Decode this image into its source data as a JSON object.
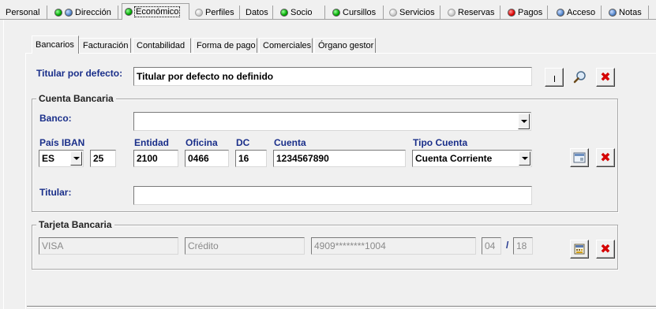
{
  "top_tabs": [
    {
      "label": "Personal",
      "leds": []
    },
    {
      "label": "Dirección",
      "leds": [
        "green",
        "blue"
      ]
    },
    {
      "label": "Económico",
      "leds": [
        "green"
      ]
    },
    {
      "label": "Perfiles",
      "leds": [
        "gray"
      ]
    },
    {
      "label": "Datos",
      "leds": []
    },
    {
      "label": "Socio",
      "leds": [
        "green"
      ]
    },
    {
      "label": "Cursillos",
      "leds": [
        "green"
      ]
    },
    {
      "label": "Servicios",
      "leds": [
        "gray"
      ]
    },
    {
      "label": "Reservas",
      "leds": [
        "gray"
      ]
    },
    {
      "label": "Pagos",
      "leds": [
        "red"
      ]
    },
    {
      "label": "Acceso",
      "leds": [
        "blue"
      ]
    },
    {
      "label": "Notas",
      "leds": [
        "blue"
      ]
    }
  ],
  "sub_tabs": [
    "Bancarios",
    "Facturación",
    "Contabilidad",
    "Forma de pago",
    "Comerciales",
    "Órgano gestor"
  ],
  "titular_defecto": {
    "label": "Titular por defecto:",
    "value": "Titular por defecto no definido"
  },
  "cuenta": {
    "legend": "Cuenta Bancaria",
    "banco_label": "Banco:",
    "banco_value": "",
    "pais_label": "País IBAN",
    "pais_value": "ES",
    "iban_check": "25",
    "entidad_label": "Entidad",
    "entidad_value": "2100",
    "oficina_label": "Oficina",
    "oficina_value": "0466",
    "dc_label": "DC",
    "dc_value": "16",
    "cuenta_label": "Cuenta",
    "cuenta_value": "1234567890",
    "tipo_label": "Tipo Cuenta",
    "tipo_value": "Cuenta Corriente",
    "titular_label": "Titular:",
    "titular_value": ""
  },
  "tarjeta": {
    "legend": "Tarjeta Bancaria",
    "marca": "VISA",
    "tipo": "Crédito",
    "numero": "4909********1004",
    "mes": "04",
    "separador": "/",
    "anio": "18"
  },
  "icons": {
    "lookup": "magnifier-icon",
    "delete": "red-x-icon",
    "card": "card-icon",
    "calculator": "calculator-icon"
  },
  "colors": {
    "label_blue": "#1a2f8a",
    "delete_red": "#d40000",
    "background": "#f0f0f0"
  }
}
